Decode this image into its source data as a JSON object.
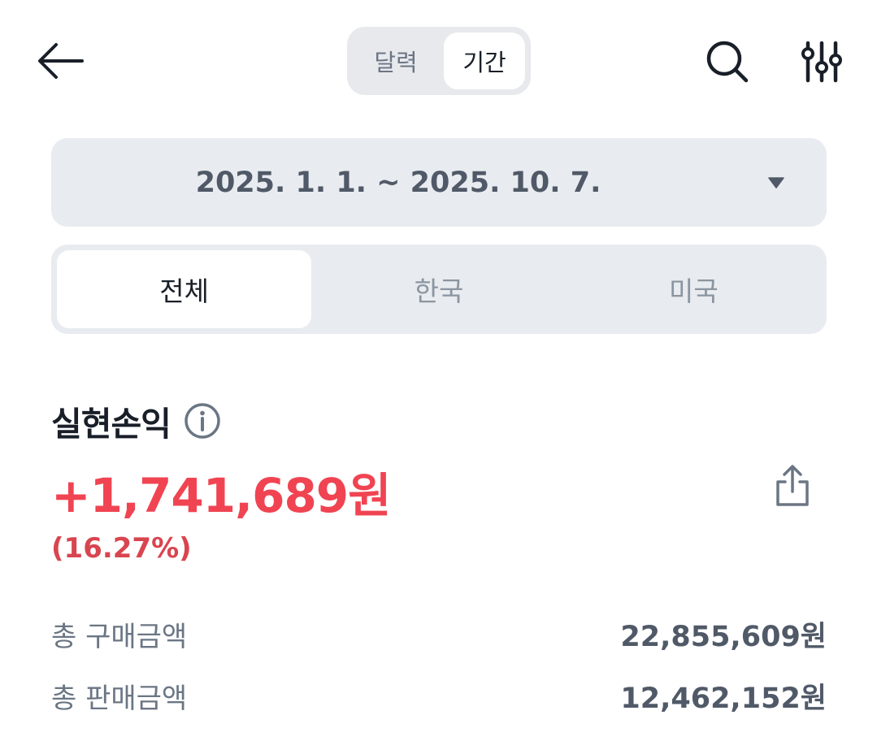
{
  "header": {
    "back_icon": "arrow-left-icon",
    "mode_options": [
      "달력",
      "기간"
    ],
    "selected_mode": "기간",
    "search_icon": "search-icon",
    "filter_icon": "sliders-icon"
  },
  "date_range": {
    "label": "2025. 1. 1. ~ 2025. 10. 7.",
    "caret_icon": "caret-down-icon"
  },
  "region_tabs": {
    "items": [
      "전체",
      "한국",
      "미국"
    ],
    "selected": "전체"
  },
  "realized_pl": {
    "title": "실현손익",
    "info_icon": "info-icon",
    "amount": "+1,741,689원",
    "rate": "(16.27%)",
    "share_icon": "share-icon"
  },
  "summary": [
    {
      "label": "총 구매금액",
      "value": "22,855,609원"
    },
    {
      "label": "총 판매금액",
      "value": "12,462,152원"
    }
  ],
  "colors": {
    "profit": "#f04452",
    "segment_bg": "#e8ebef",
    "text_primary": "#191f28",
    "text_secondary": "#6b7684"
  }
}
